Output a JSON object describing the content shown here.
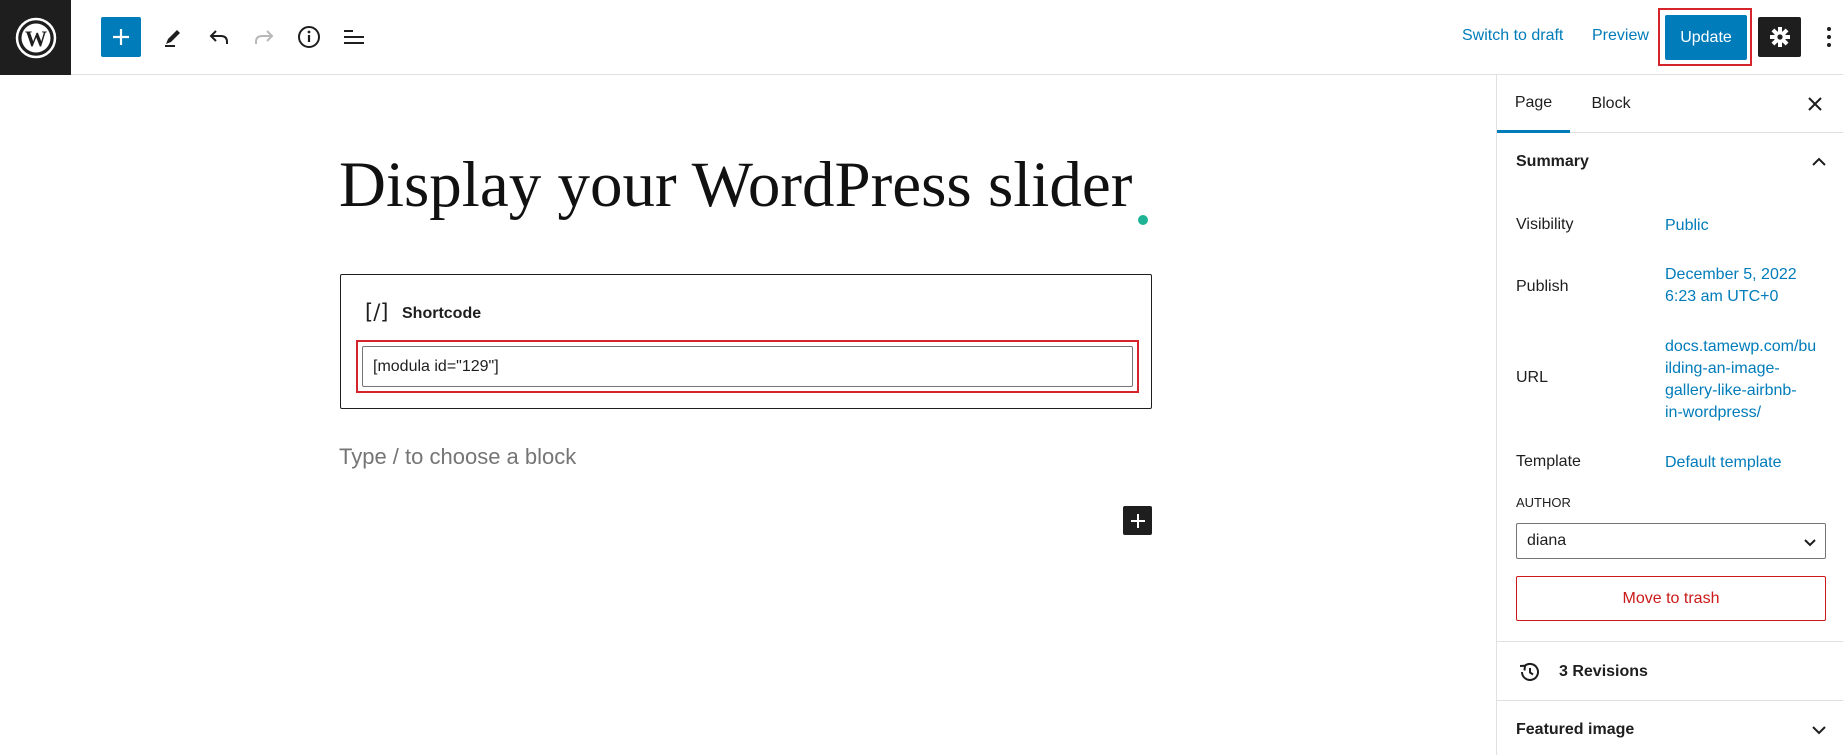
{
  "toolbar": {
    "switch_to_draft": "Switch to draft",
    "preview": "Preview",
    "update": "Update"
  },
  "editor": {
    "title": "Display your WordPress slider",
    "shortcode_block": {
      "label": "Shortcode",
      "icon_glyph": "[/]",
      "value": "[modula id=\"129\"]"
    },
    "appender_placeholder": "Type / to choose a block"
  },
  "sidebar": {
    "tabs": [
      "Page",
      "Block"
    ],
    "summary": {
      "title": "Summary",
      "visibility_label": "Visibility",
      "visibility_value": "Public",
      "publish_label": "Publish",
      "publish_value_line1": "December 5, 2022",
      "publish_value_line2": "6:23 am UTC+0",
      "url_label": "URL",
      "url_lines": [
        "docs.tamewp.com/bu",
        "ilding-an-image-",
        "gallery-like-airbnb-",
        "in-wordpress/"
      ],
      "template_label": "Template",
      "template_value": "Default template",
      "author_label": "AUTHOR",
      "author_value": "diana",
      "trash_label": "Move to trash"
    },
    "revisions": "3 Revisions",
    "featured_image": "Featured image"
  },
  "colors": {
    "accent": "#007cba",
    "highlight_outline": "#d5242c",
    "danger": "#cc1818",
    "dark": "#1e1e1e",
    "title_dot": "#1fb395"
  },
  "icons": [
    "wordpress-logo-icon",
    "plus-icon",
    "pencil-icon",
    "undo-icon",
    "redo-icon",
    "info-icon",
    "list-view-icon",
    "gear-icon",
    "kebab-icon",
    "close-icon",
    "chevron-up-icon",
    "chevron-down-icon",
    "history-icon"
  ]
}
